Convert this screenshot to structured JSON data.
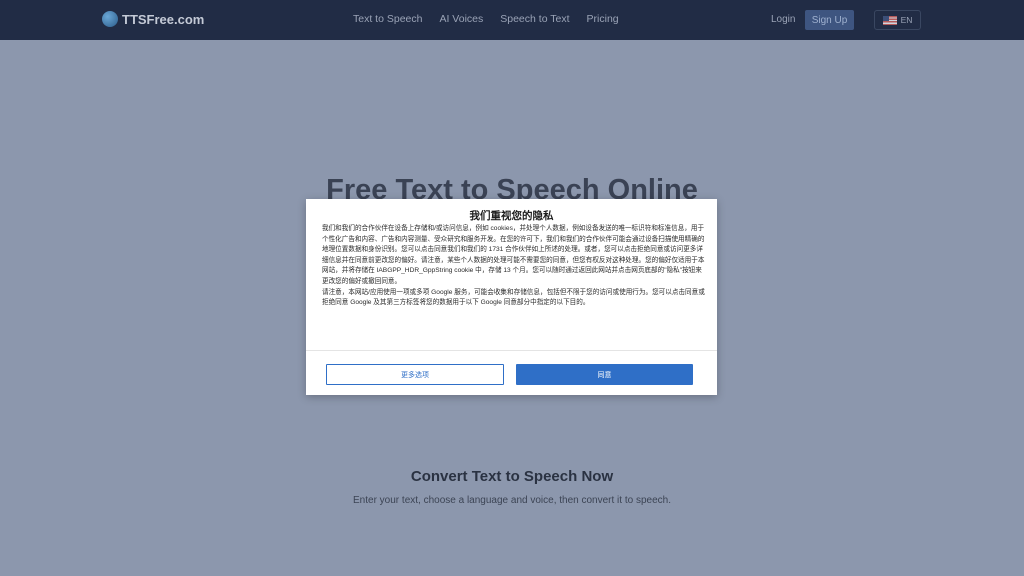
{
  "brand": {
    "name": "TTSFree.com",
    "icon": "logo-mark-icon"
  },
  "nav": {
    "links": [
      "Text to Speech",
      "AI Voices",
      "Speech to Text",
      "Pricing"
    ],
    "login": "Login",
    "signup": "Sign Up",
    "language": "EN",
    "flag_icon": "us-flag-icon"
  },
  "hero": {
    "title": "Free Text to Speech Online"
  },
  "section": {
    "title": "Convert Text to Speech Now",
    "subtitle": "Enter your text, choose a language and voice, then convert it to speech."
  },
  "consent": {
    "title": "我们重视您的隐私",
    "paragraph1": "我们和我们的合作伙伴在设备上存储和/或访问信息，例如 cookies，并处理个人数据，例如设备发送的唯一标识符和标准信息，用于个性化广告和内容、广告和内容测量、受众研究和服务开发。在您的许可下，我们和我们的合作伙伴可能会通过设备扫描使用精确的地理位置数据和身份识别。您可以点击同意我们和我们的 1731 合作伙伴如上所述的处理。或者，您可以点击拒绝同意或访问更多详细信息并在同意前更改您的偏好。请注意，某些个人数据的处理可能不需要您的同意，但您有权反对这种处理。您的偏好仅适用于本网站，并将存储在 IABGPP_HDR_GppString cookie 中，存储 13 个月。您可以随时通过返回此网站并点击网页底部的\"隐私\"按钮来更改您的偏好或撤回同意。",
    "paragraph2": "请注意，本网站/应用使用一项或多项 Google 服务，可能会收集和存储信息，包括但不限于您的访问或使用行为。您可以点击同意或拒绝同意 Google 及其第三方标签将您的数据用于以下 Google 同意部分中指定的以下目的。",
    "more_options": "更多选项",
    "agree": "同意"
  },
  "colors": {
    "accent": "#2f6fc7",
    "navbar": "#212c45",
    "overlay": "#8c97ad"
  }
}
